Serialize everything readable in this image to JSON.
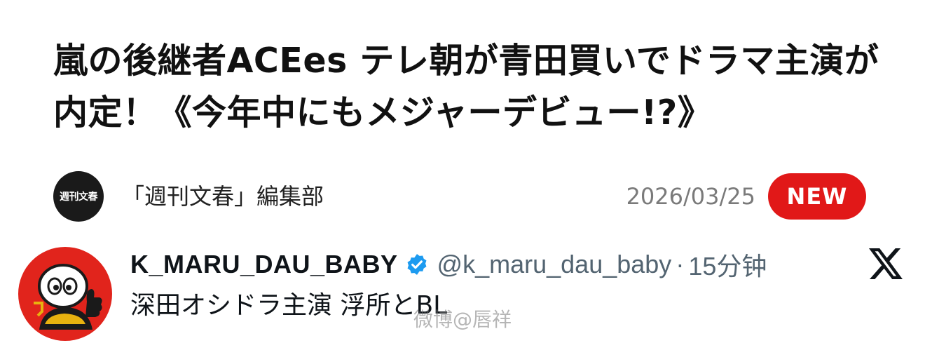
{
  "article": {
    "title": "嵐の後継者ACEes テレ朝が青田買いでドラマ主演が内定！《今年中にもメジャーデビュー!?》",
    "publisher_logo_text": "週刊文春",
    "publisher": "「週刊文春」編集部",
    "date": "2026/03/25",
    "badge": "NEW"
  },
  "tweet": {
    "display_name": "K_MARU_DAU_BABY",
    "handle": "@k_maru_dau_baby",
    "separator": "·",
    "time": "15分钟",
    "text": "深田オシドラ主演 浮所とBL",
    "verified_icon": "verified-badge-icon",
    "platform_icon": "x-logo-icon"
  },
  "watermark": "微博@唇祥",
  "colors": {
    "badge_red": "#e11818",
    "verified_blue": "#1d9bf0",
    "handle_gray": "#536471",
    "date_gray": "#7a7a7a"
  }
}
